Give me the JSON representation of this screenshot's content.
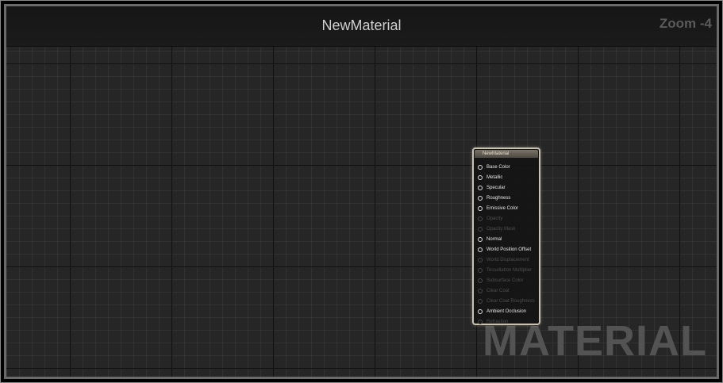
{
  "editor": {
    "title": "NewMaterial",
    "zoom": "Zoom -4",
    "watermark": "MATERIAL"
  },
  "node": {
    "header": "NewMaterial",
    "pins": [
      {
        "label": "Base Color",
        "enabled": true
      },
      {
        "label": "Metallic",
        "enabled": true
      },
      {
        "label": "Specular",
        "enabled": true
      },
      {
        "label": "Roughness",
        "enabled": true
      },
      {
        "label": "Emissive Color",
        "enabled": true
      },
      {
        "label": "Opacity",
        "enabled": false
      },
      {
        "label": "Opacity Mask",
        "enabled": false
      },
      {
        "label": "Normal",
        "enabled": true
      },
      {
        "label": "World Position Offset",
        "enabled": true
      },
      {
        "label": "World Displacement",
        "enabled": false
      },
      {
        "label": "Tessellation Multiplier",
        "enabled": false
      },
      {
        "label": "Subsurface Color",
        "enabled": false
      },
      {
        "label": "Clear Coat",
        "enabled": false
      },
      {
        "label": "Clear Coat Roughness",
        "enabled": false
      },
      {
        "label": "Ambient Occlusion",
        "enabled": true
      },
      {
        "label": "Refraction",
        "enabled": false
      }
    ]
  }
}
